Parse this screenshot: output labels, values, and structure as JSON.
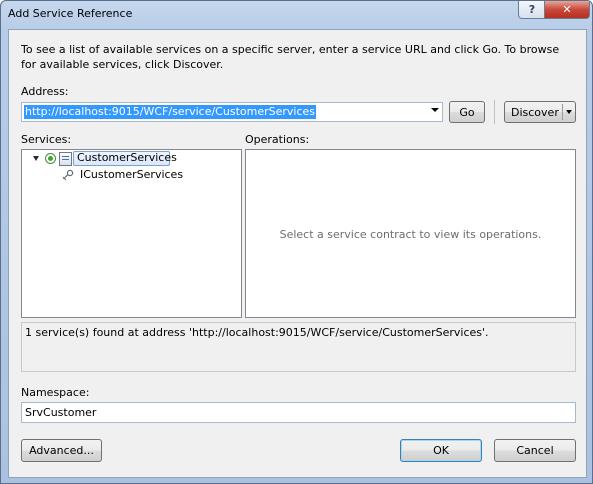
{
  "window": {
    "title": "Add Service Reference",
    "help_label": "?",
    "close_label": "✕"
  },
  "intro_text": "To see a list of available services on a specific server, enter a service URL and click Go. To browse for available services, click Discover.",
  "address": {
    "label": "Address:",
    "value": "http://localhost:9015/WCF/service/CustomerServices"
  },
  "buttons": {
    "go": "Go",
    "discover": "Discover",
    "advanced": "Advanced...",
    "ok": "OK",
    "cancel": "Cancel"
  },
  "services": {
    "label": "Services:",
    "tree": [
      {
        "label": "CustomerServices",
        "icon": "service-icon",
        "expanded": true,
        "selected": true
      },
      {
        "label": "ICustomerServices",
        "icon": "contract-icon"
      }
    ]
  },
  "operations": {
    "label": "Operations:",
    "empty_message": "Select a service contract to view its operations."
  },
  "status_text": "1 service(s) found at address 'http://localhost:9015/WCF/service/CustomerServices'.",
  "namespace": {
    "label": "Namespace:",
    "value": "SrvCustomer"
  }
}
